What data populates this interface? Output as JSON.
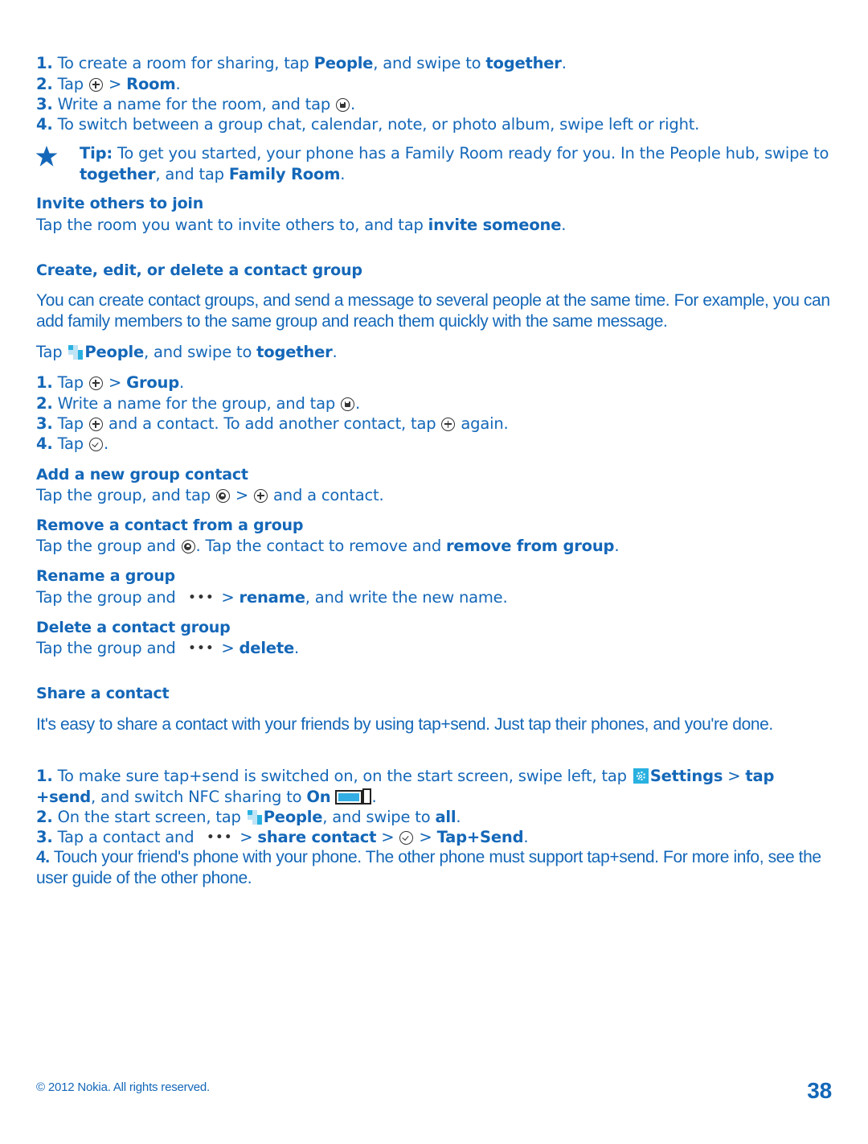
{
  "room_steps": [
    {
      "num": "1.",
      "t1": "To create a room for sharing, tap ",
      "b1": "People",
      "t2": ", and swipe to ",
      "b2": "together",
      "t3": "."
    },
    {
      "num": "2.",
      "t1": "Tap ",
      "t2": " > ",
      "b1": "Room",
      "t3": "."
    },
    {
      "num": "3.",
      "t1": "Write a name for the room, and tap ",
      "t2": "."
    },
    {
      "num": "4.",
      "t1": "To switch between a group chat, calendar, note, or photo album, swipe left or right."
    }
  ],
  "tip": {
    "label": "Tip:",
    "t1": " To get you started, your phone has a Family Room ready for you. In the People hub, swipe to ",
    "b1": "together",
    "t2": ", and tap ",
    "b2": "Family Room",
    "t3": "."
  },
  "invite": {
    "heading": "Invite others to join",
    "t1": "Tap the room you want to invite others to, and tap ",
    "b1": "invite someone",
    "t2": "."
  },
  "contact_group": {
    "heading": "Create, edit, or delete a contact group",
    "intro": "You can create contact groups, and send a message to several people at the same time. For example, you can add family members to the same group and reach them quickly with the same message.",
    "tap_line": {
      "t1": "Tap ",
      "b1": "People",
      "t2": ", and swipe to ",
      "b2": "together",
      "t3": "."
    },
    "steps": [
      {
        "num": "1.",
        "t1": "Tap ",
        "t2": " > ",
        "b1": "Group",
        "t3": "."
      },
      {
        "num": "2.",
        "t1": "Write a name for the group, and tap ",
        "t2": "."
      },
      {
        "num": "3.",
        "t1": "Tap ",
        "t2": " and a contact. To add another contact, tap ",
        "t3": " again."
      },
      {
        "num": "4.",
        "t1": "Tap ",
        "t2": "."
      }
    ]
  },
  "add_contact": {
    "heading": "Add a new group contact",
    "t1": "Tap the group, and tap ",
    "t2": " > ",
    "t3": " and a contact."
  },
  "remove_contact": {
    "heading": "Remove a contact from a group",
    "t1": "Tap the group and ",
    "t2": ". Tap the contact to remove and ",
    "b1": "remove from group",
    "t3": "."
  },
  "rename": {
    "heading": "Rename a group",
    "t1": "Tap the group and ",
    "dots": "•••",
    "t2": "> ",
    "b1": "rename",
    "t3": ", and write the new name."
  },
  "delete": {
    "heading": "Delete a contact group",
    "t1": "Tap the group and ",
    "dots": "•••",
    "t2": "> ",
    "b1": "delete",
    "t3": "."
  },
  "share": {
    "heading": "Share a contact",
    "intro": "It's easy to share a contact with your friends by using tap+send. Just tap their phones, and you're done.",
    "step1": {
      "num": "1.",
      "t1": "To make sure tap+send is switched on, on the start screen, swipe left, tap ",
      "b1": "Settings",
      "t2": " > ",
      "b2": "tap +send",
      "t3": ", and switch NFC sharing to ",
      "b3": "On",
      "t4": "."
    },
    "step2": {
      "num": "2.",
      "t1": "On the start screen, tap ",
      "b1": "People",
      "t2": ", and swipe to ",
      "b2": "all",
      "t3": "."
    },
    "step3": {
      "num": "3.",
      "t1": "Tap a contact and ",
      "dots": "•••",
      "t2": "> ",
      "b1": "share contact",
      "t3": " > ",
      "t4": " > ",
      "b2": "Tap+Send",
      "t5": "."
    },
    "step4": {
      "num": "4.",
      "t1": "Touch your friend's phone with your phone. The other phone must support tap+send. For more info, see the user guide of the other phone."
    }
  },
  "footer": {
    "copyright": "© 2012 Nokia. All rights reserved.",
    "page": "38"
  },
  "colors": {
    "text": "#1467b8",
    "icon": "#333333",
    "tile_accent": "#29b1e0"
  }
}
